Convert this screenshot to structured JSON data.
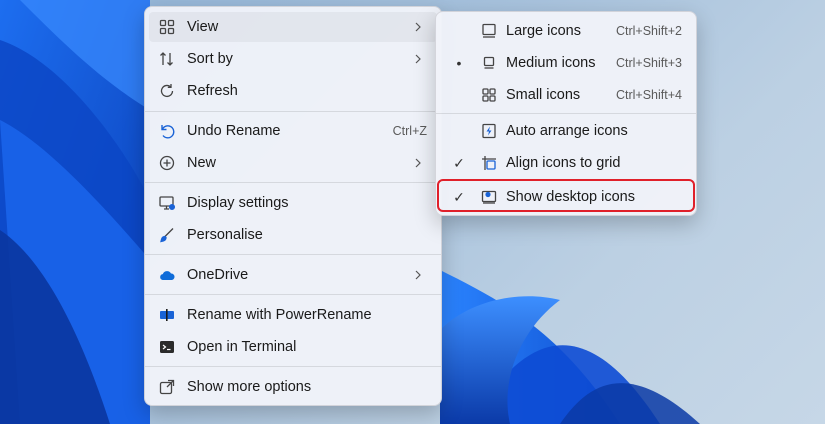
{
  "colors": {
    "accent": "#0a5fd8",
    "highlight": "#e0202a"
  },
  "main_menu": {
    "items": [
      {
        "label": "View",
        "icon": "grid-icon",
        "submenu": true
      },
      {
        "label": "Sort by",
        "icon": "sort-icon",
        "submenu": true
      },
      {
        "label": "Refresh",
        "icon": "refresh-icon"
      },
      {
        "label": "Undo Rename",
        "icon": "undo-icon",
        "shortcut": "Ctrl+Z"
      },
      {
        "label": "New",
        "icon": "plus-circle-icon",
        "submenu": true
      },
      {
        "label": "Display settings",
        "icon": "display-settings-icon"
      },
      {
        "label": "Personalise",
        "icon": "brush-icon"
      },
      {
        "label": "OneDrive",
        "icon": "onedrive-cloud-icon",
        "submenu": true
      },
      {
        "label": "Rename with PowerRename",
        "icon": "powerrename-icon"
      },
      {
        "label": "Open in Terminal",
        "icon": "terminal-icon"
      },
      {
        "label": "Show more options",
        "icon": "share-expand-icon"
      }
    ]
  },
  "view_submenu": {
    "items": [
      {
        "label": "Large icons",
        "icon": "large-icons-icon",
        "shortcut": "Ctrl+Shift+2",
        "mark": ""
      },
      {
        "label": "Medium icons",
        "icon": "medium-icons-icon",
        "shortcut": "Ctrl+Shift+3",
        "mark": "•"
      },
      {
        "label": "Small icons",
        "icon": "small-icons-icon",
        "shortcut": "Ctrl+Shift+4",
        "mark": ""
      },
      {
        "label": "Auto arrange icons",
        "icon": "auto-arrange-icon",
        "mark": ""
      },
      {
        "label": "Align icons to grid",
        "icon": "align-grid-icon",
        "mark": "✓"
      },
      {
        "label": "Show desktop icons",
        "icon": "show-desktop-icon",
        "mark": "✓"
      }
    ]
  }
}
